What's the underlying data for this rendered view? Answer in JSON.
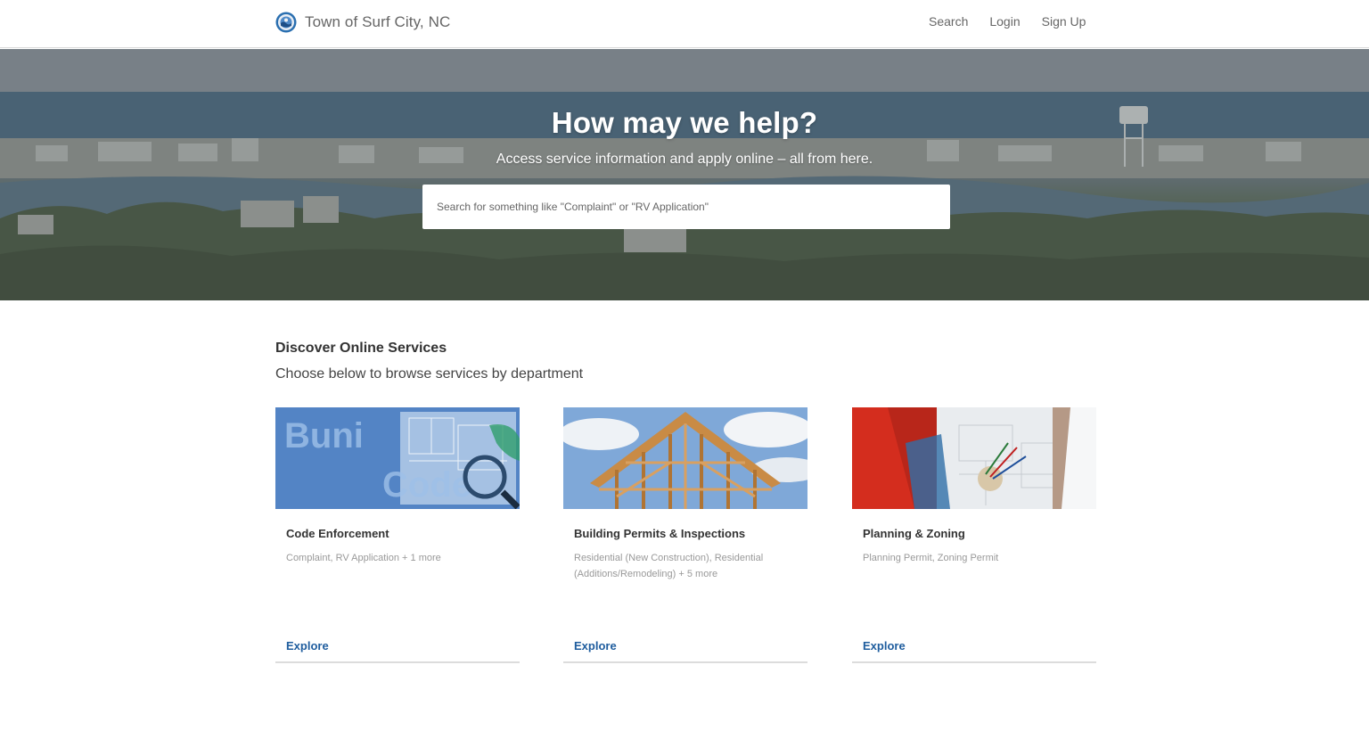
{
  "header": {
    "site_name": "Town of Surf City, NC",
    "nav": {
      "search": "Search",
      "login": "Login",
      "signup": "Sign Up"
    }
  },
  "hero": {
    "title": "How may we help?",
    "subtitle": "Access service information and apply online – all from here.",
    "search_placeholder": "Search for something like \"Complaint\" or \"RV Application\""
  },
  "services": {
    "title": "Discover Online Services",
    "subtitle": "Choose below to browse services by department",
    "cards": [
      {
        "title": "Code Enforcement",
        "description": "Complaint, RV Application + 1 more",
        "link": "Explore"
      },
      {
        "title": "Building Permits & Inspections",
        "description": "Residential (New Construction), Residential (Additions/Remodeling) + 5 more",
        "link": "Explore"
      },
      {
        "title": "Planning & Zoning",
        "description": "Planning Permit, Zoning Permit",
        "link": "Explore"
      }
    ]
  },
  "colors": {
    "link": "#1f5d9e",
    "accent_logo": "#2a6fb0"
  },
  "icons": {
    "brand_logo": "town-seal-icon"
  }
}
